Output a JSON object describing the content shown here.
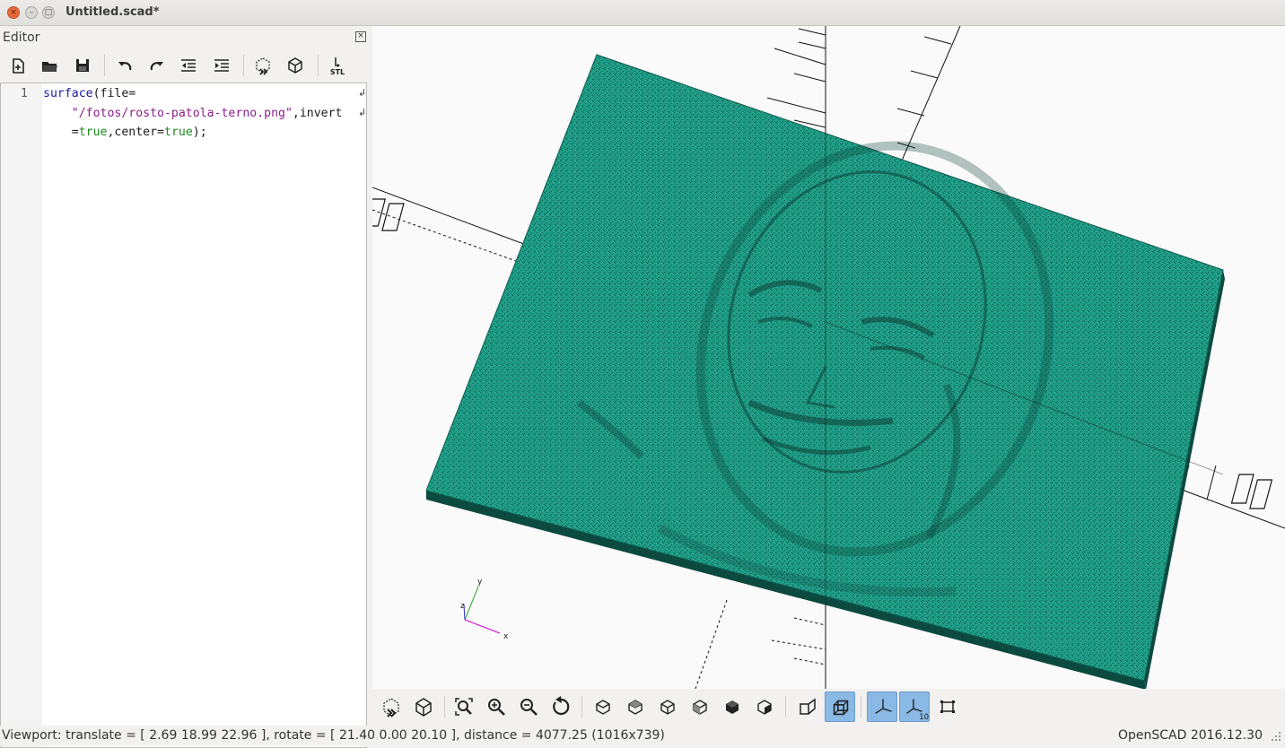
{
  "window": {
    "title": "Untitled.scad*"
  },
  "editor": {
    "label": "Editor",
    "toolbar": [
      "new-file",
      "open-file",
      "save-file",
      "undo",
      "redo",
      "unindent",
      "indent",
      "preview",
      "render",
      "export-stl"
    ],
    "stl_label": "STL",
    "line_number": "1",
    "code": {
      "l1_fn": "surface",
      "l1_rest": "(file=",
      "l2_str": "\"/fotos/rosto-patola-terno.png\"",
      "l2_rest": ",invert",
      "l3_a": "=",
      "l3_true1": "true",
      "l3_b": ",center=",
      "l3_true2": "true",
      "l3_c": ");"
    }
  },
  "viewport": {
    "model_color": "#1f9c86",
    "axis_labels": {
      "x": "x",
      "y": "y",
      "z": "z"
    },
    "scale_label": "10",
    "toolbar": [
      "preview",
      "render",
      "view-all",
      "zoom-in",
      "zoom-out",
      "reset-view",
      "view-right",
      "view-top",
      "view-bottom",
      "view-left",
      "view-front",
      "view-back",
      "perspective",
      "orthogonal",
      "show-axes",
      "show-scale-markers",
      "show-edges"
    ],
    "active_buttons": [
      "orthogonal",
      "show-axes",
      "show-scale-markers"
    ]
  },
  "status": {
    "viewport_text": "Viewport: translate = [ 2.69 18.99 22.96 ], rotate = [ 21.40 0.00 20.10 ], distance = 4077.25 (1016x739)",
    "version": "OpenSCAD 2016.12.30"
  }
}
